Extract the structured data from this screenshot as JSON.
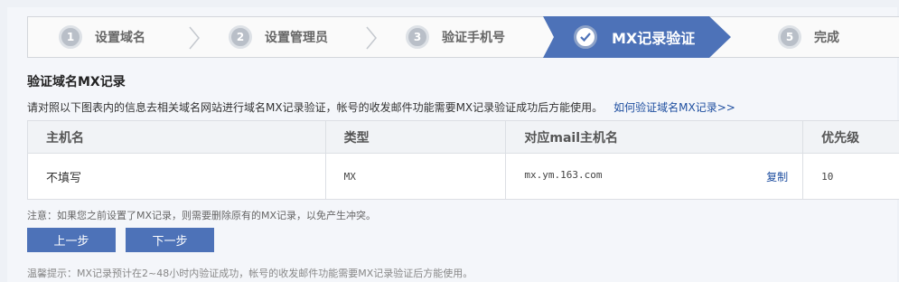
{
  "steps": [
    {
      "num": "1",
      "label": "设置域名"
    },
    {
      "num": "2",
      "label": "设置管理员"
    },
    {
      "num": "3",
      "label": "验证手机号"
    },
    {
      "num": "✓",
      "label": "MX记录验证"
    },
    {
      "num": "5",
      "label": "完成"
    }
  ],
  "colors": {
    "accent": "#4d72b8",
    "link": "#1f4fa0"
  },
  "section": {
    "title": "验证域名MX记录",
    "description": "请对照以下图表内的信息去相关域名网站进行域名MX记录验证，帐号的收发邮件功能需要MX记录验证成功后方能使用。",
    "help_link": "如何验证域名MX记录>>"
  },
  "table": {
    "headers": [
      "主机名",
      "类型",
      "对应mail主机名",
      "优先级"
    ],
    "row": {
      "host": "不填写",
      "type": "MX",
      "mail_host": "mx.ym.163.com",
      "copy": "复制",
      "priority": "10"
    }
  },
  "note": "注意：如果您之前设置了MX记录，则需要删除原有的MX记录，以免产生冲突。",
  "buttons": {
    "prev": "上一步",
    "next": "下一步"
  },
  "tip": "温馨提示：MX记录预计在2~48小时内验证成功，帐号的收发邮件功能需要MX记录验证后方能使用。"
}
